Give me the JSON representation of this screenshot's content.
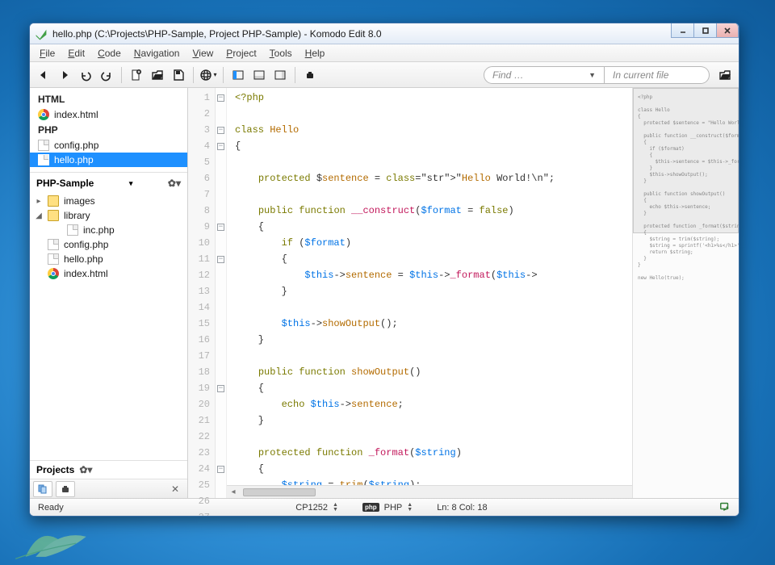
{
  "window": {
    "title": "hello.php (C:\\Projects\\PHP-Sample, Project PHP-Sample) - Komodo Edit 8.0"
  },
  "menubar": {
    "items": [
      "File",
      "Edit",
      "Code",
      "Navigation",
      "View",
      "Project",
      "Tools",
      "Help"
    ]
  },
  "toolbar": {
    "find_placeholder": "Find …",
    "scope_label": "In current file"
  },
  "sidebar": {
    "groups": [
      {
        "label": "HTML",
        "items": [
          {
            "icon": "chrome",
            "name": "index.html"
          }
        ]
      },
      {
        "label": "PHP",
        "items": [
          {
            "icon": "doc",
            "name": "config.php"
          },
          {
            "icon": "doc",
            "name": "hello.php",
            "selected": true
          }
        ]
      }
    ],
    "project_name": "PHP-Sample",
    "tree": [
      {
        "icon": "folder",
        "name": "images",
        "arrow": "▸"
      },
      {
        "icon": "folder",
        "name": "library",
        "arrow": "◢",
        "children": [
          {
            "icon": "doc",
            "name": "inc.php"
          }
        ]
      },
      {
        "icon": "doc",
        "name": "config.php"
      },
      {
        "icon": "doc",
        "name": "hello.php"
      },
      {
        "icon": "chrome",
        "name": "index.html"
      }
    ],
    "projects_label": "Projects"
  },
  "editor": {
    "fold_lines": [
      1,
      3,
      4,
      9,
      11,
      19,
      24
    ],
    "lines": [
      "<?php",
      "",
      "class Hello",
      "{",
      "",
      "    protected $sentence = \"Hello World!\\n\";",
      "",
      "    public function __construct($format = false)",
      "    {",
      "        if ($format)",
      "        {",
      "            $this->sentence = $this->_format($this->",
      "        }",
      "",
      "        $this->showOutput();",
      "    }",
      "",
      "    public function showOutput()",
      "    {",
      "        echo $this->sentence;",
      "    }",
      "",
      "    protected function _format($string)",
      "    {",
      "        $string = trim($string);",
      "        $string = sprintf('<h1>%s</h1>', $string);",
      "        return $string;",
      "    }"
    ]
  },
  "statusbar": {
    "ready": "Ready",
    "encoding": "CP1252",
    "lang_badge": "php",
    "lang": "PHP",
    "position": "Ln: 8 Col: 18"
  }
}
